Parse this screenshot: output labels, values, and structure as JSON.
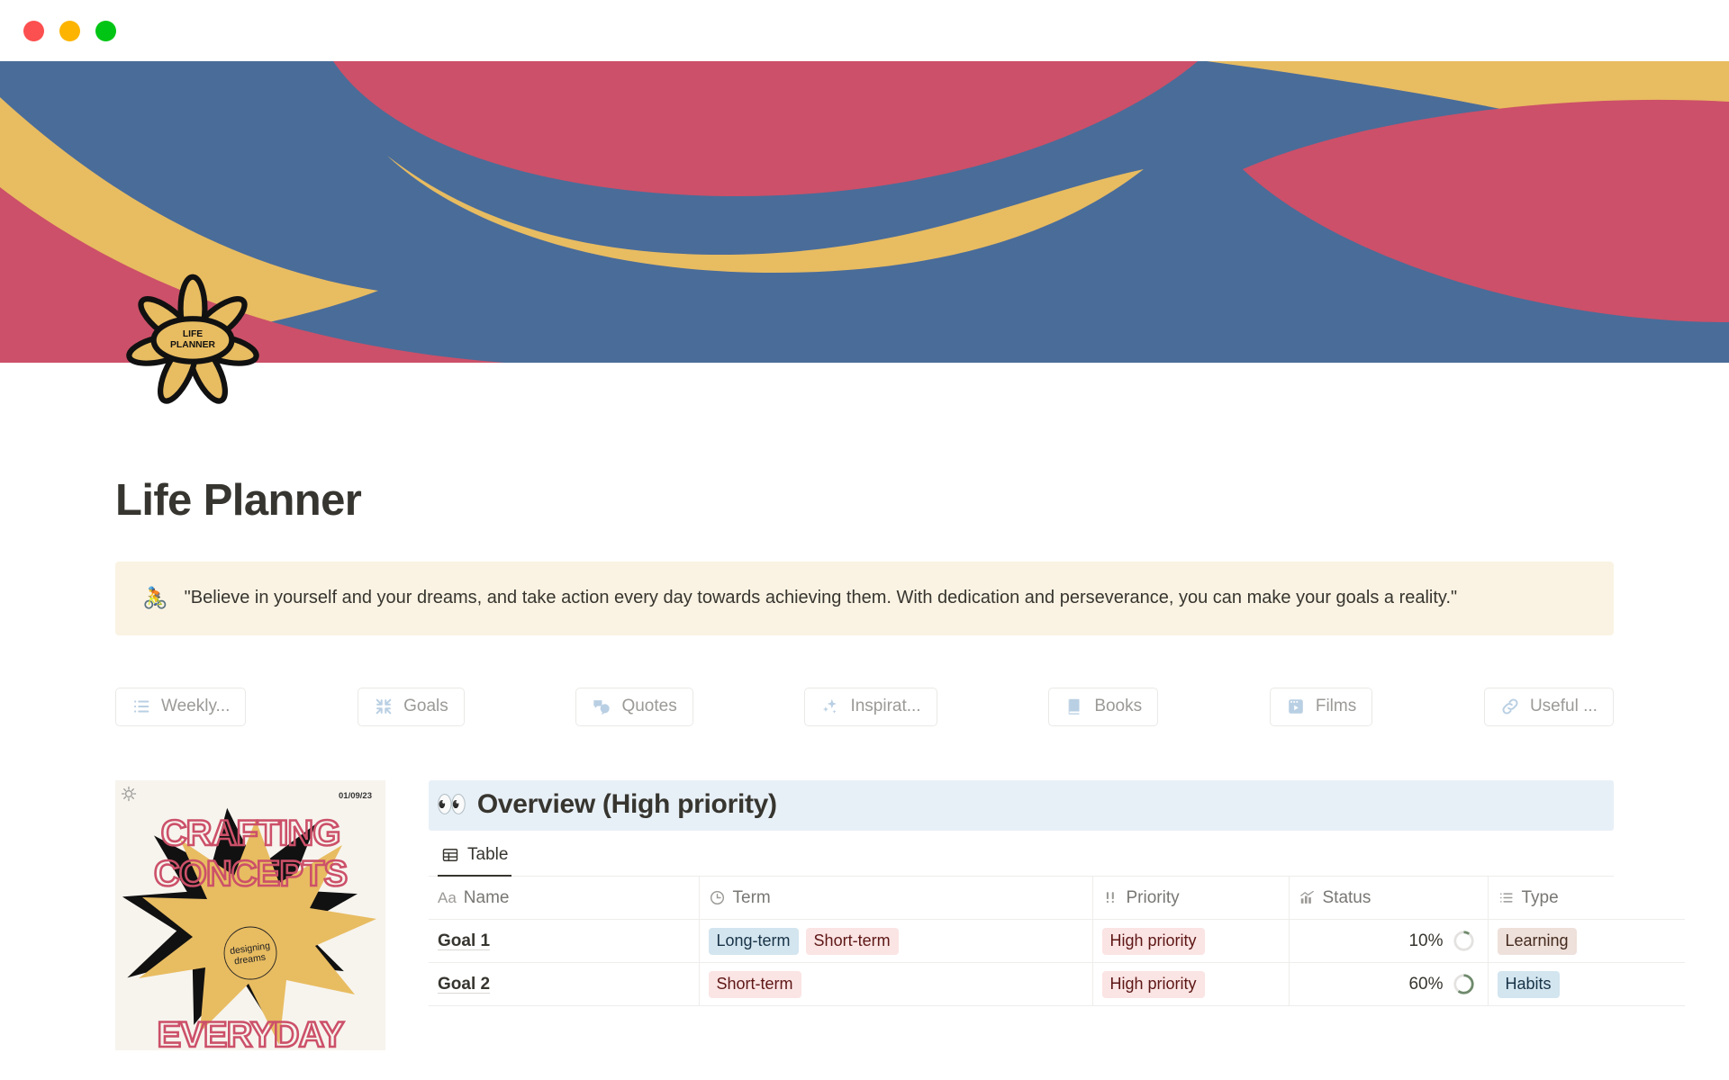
{
  "window": {
    "controls": [
      "close",
      "minimize",
      "maximize"
    ]
  },
  "cover": {
    "colors": {
      "blue": "#4a6c99",
      "red": "#cc5069",
      "yellow": "#e8bc61"
    }
  },
  "page_icon": {
    "label_line1": "LIFE",
    "label_line2": "PLANNER",
    "fill": "#e8bc61"
  },
  "page": {
    "title": "Life Planner"
  },
  "callout": {
    "emoji": "🚴",
    "emoji_name": "cyclist-emoji",
    "text": "\"Believe in yourself and your dreams, and take action every day towards achieving them. With dedication and perseverance, you can make your goals a reality.\"",
    "background": "#faf3e3"
  },
  "nav": {
    "items": [
      {
        "label": "Weekly...",
        "icon": "list-icon"
      },
      {
        "label": "Goals",
        "icon": "compress-arrows-icon"
      },
      {
        "label": "Quotes",
        "icon": "speech-bubbles-icon"
      },
      {
        "label": "Inspirat...",
        "icon": "sparkles-icon"
      },
      {
        "label": "Books",
        "icon": "book-icon"
      },
      {
        "label": "Films",
        "icon": "film-icon"
      },
      {
        "label": "Useful ...",
        "icon": "link-icon"
      }
    ]
  },
  "poster": {
    "date": "01/09/23",
    "line1": "CRAFTING",
    "line2": "CONCEPTS",
    "line3": "EVERYDAY",
    "badge_line1": "designing",
    "badge_line2": "dreams",
    "gear_icon": "gear-icon",
    "colors": {
      "background": "#f7f4ee",
      "flower": "#e8bc61",
      "text": "#cc5069"
    }
  },
  "database": {
    "title_emoji": "👀",
    "title_emoji_name": "eyes-emoji",
    "title": "Overview (High priority)",
    "title_background": "#e8f0f7",
    "tabs": [
      {
        "label": "Table",
        "icon": "table-icon",
        "active": true
      }
    ],
    "columns": [
      {
        "label": "Name",
        "icon": "title-aa-icon"
      },
      {
        "label": "Term",
        "icon": "clock-icon"
      },
      {
        "label": "Priority",
        "icon": "double-exclamation-icon"
      },
      {
        "label": "Status",
        "icon": "chart-icon"
      },
      {
        "label": "Type",
        "icon": "list-icon"
      }
    ],
    "rows": [
      {
        "name": "Goal 1",
        "term": [
          {
            "label": "Long-term",
            "color": "blue"
          },
          {
            "label": "Short-term",
            "color": "pink"
          }
        ],
        "priority": [
          {
            "label": "High priority",
            "color": "pink"
          }
        ],
        "status_percent": "10%",
        "status_value": 10,
        "type": [
          {
            "label": "Learning",
            "color": "brown"
          }
        ]
      },
      {
        "name": "Goal 2",
        "term": [
          {
            "label": "Short-term",
            "color": "pink"
          }
        ],
        "priority": [
          {
            "label": "High priority",
            "color": "pink"
          }
        ],
        "status_percent": "60%",
        "status_value": 60,
        "type": [
          {
            "label": "Habits",
            "color": "blue"
          }
        ]
      }
    ]
  }
}
